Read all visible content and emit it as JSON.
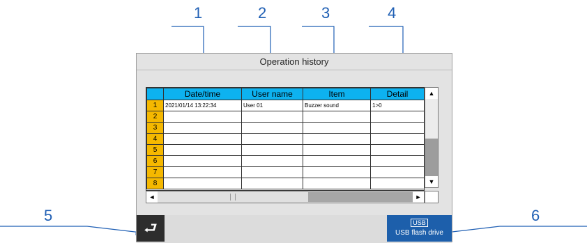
{
  "window": {
    "title": "Operation history"
  },
  "callouts": [
    "1",
    "2",
    "3",
    "4",
    "5",
    "6"
  ],
  "table": {
    "headers": [
      "Date/time",
      "User name",
      "Item",
      "Detail"
    ],
    "row_numbers": [
      "1",
      "2",
      "3",
      "4",
      "5",
      "6",
      "7",
      "8"
    ],
    "rows": [
      {
        "datetime": "2021/01/14   13:22:34",
        "user": "User 01",
        "item": "Buzzer sound",
        "detail": "1>0"
      }
    ]
  },
  "scrollbars": {
    "up_arrow": "▲",
    "down_arrow": "▼",
    "left_arrow": "◄",
    "right_arrow": "►"
  },
  "buttons": {
    "back_icon": "return-arrow-icon",
    "back_glyph": "⮐",
    "usb_icon_label": "USB",
    "usb_label": "USB flash drive"
  },
  "colors": {
    "header": "#0db2f0",
    "row_number": "#f5b800",
    "usb_button": "#1d5fab",
    "back_button": "#2d2d2d",
    "callout": "#1f5fb4"
  }
}
